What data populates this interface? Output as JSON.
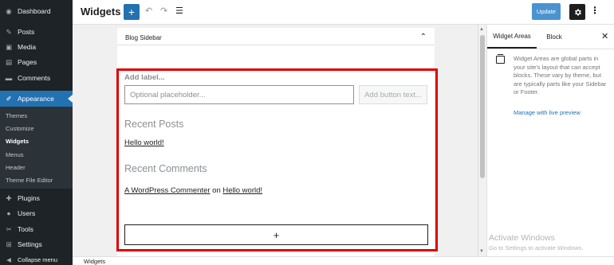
{
  "sidebar": {
    "items": [
      {
        "label": "Dashboard",
        "icon": "dashboard-icon",
        "glyph": "◉"
      },
      {
        "label": "Posts",
        "icon": "pin-icon",
        "glyph": "✎"
      },
      {
        "label": "Media",
        "icon": "media-icon",
        "glyph": "▣"
      },
      {
        "label": "Pages",
        "icon": "pages-icon",
        "glyph": "▤"
      },
      {
        "label": "Comments",
        "icon": "comments-icon",
        "glyph": "▬"
      },
      {
        "label": "Appearance",
        "icon": "appearance-icon",
        "glyph": "✐"
      },
      {
        "label": "Plugins",
        "icon": "plugins-icon",
        "glyph": "✚"
      },
      {
        "label": "Users",
        "icon": "users-icon",
        "glyph": "●"
      },
      {
        "label": "Tools",
        "icon": "tools-icon",
        "glyph": "✂"
      },
      {
        "label": "Settings",
        "icon": "settings-icon",
        "glyph": "⊞"
      },
      {
        "label": "Collapse menu",
        "icon": "collapse-icon",
        "glyph": "◀"
      }
    ],
    "appearance_submenu": [
      "Themes",
      "Customize",
      "Widgets",
      "Menus",
      "Header",
      "Theme File Editor"
    ]
  },
  "header": {
    "title": "Widgets",
    "add_glyph": "+",
    "undo_glyph": "↶",
    "redo_glyph": "↷",
    "list_glyph": "☰",
    "update_label": "Update",
    "more_glyph": "⋮"
  },
  "widget_area": {
    "title": "Blog Sidebar",
    "chevron": "⌃"
  },
  "search_block": {
    "label": "Add label...",
    "placeholder": "Optional placeholder...",
    "button": "Add button text..."
  },
  "recent_posts": {
    "heading": "Recent Posts",
    "items": [
      "Hello world!"
    ]
  },
  "recent_comments": {
    "heading": "Recent Comments",
    "author": "A WordPress Commenter",
    "on": " on ",
    "post": "Hello world!"
  },
  "add_block_glyph": "+",
  "panel": {
    "tab_areas": "Widget Areas",
    "tab_block": "Block",
    "close_glyph": "✕",
    "description": "Widget Areas are global parts in your site's layout that can accept blocks. These vary by theme, but are typically parts like your Sidebar or Footer.",
    "link": "Manage with live preview"
  },
  "watermark": {
    "title": "Activate Windows",
    "subtitle": "Go to Settings to activate Windows."
  },
  "footer": {
    "breadcrumb": "Widgets"
  },
  "colors": {
    "sidebar_bg": "#1d2327",
    "accent": "#2271b1",
    "highlight": "#e00000"
  }
}
